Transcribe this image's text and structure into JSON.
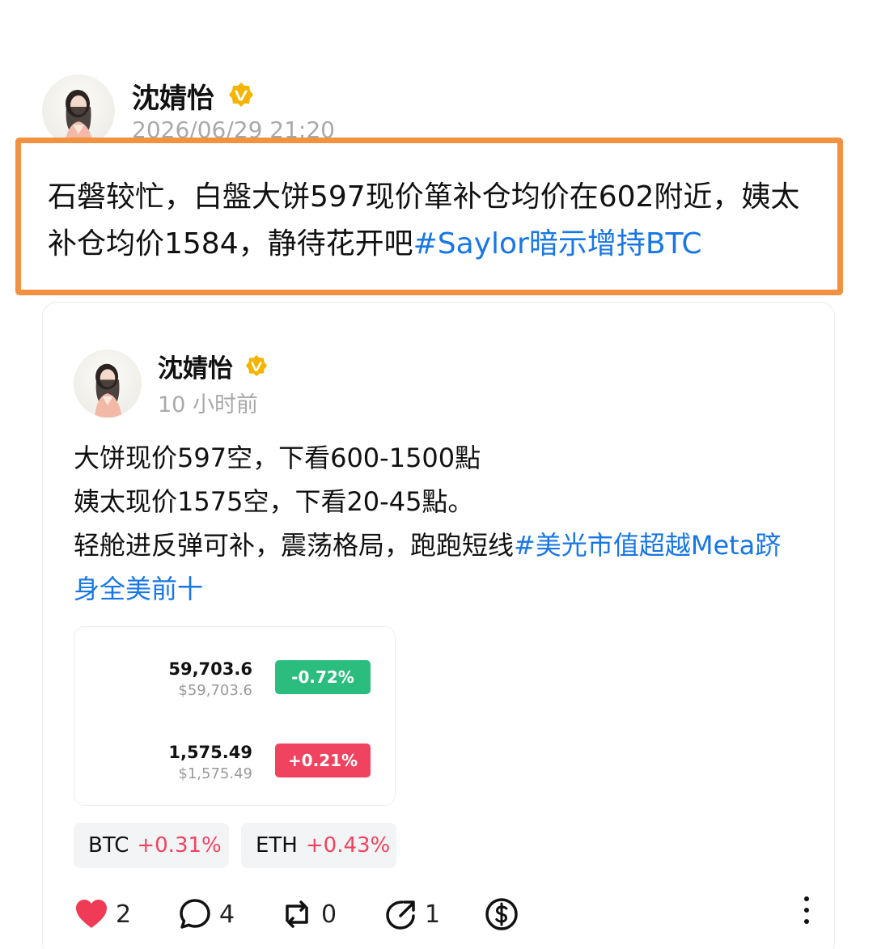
{
  "outer_post": {
    "author": "沈婧怡",
    "timestamp": "2026/06/29 21:20",
    "text": "石磐较忙，白盤大饼597现价箪补仓均价在602附近，姨太补仓均价1584，静待花开吧",
    "hashtag": "#Saylor暗示增持BTC"
  },
  "quoted_post": {
    "author": "沈婧怡",
    "timestamp": "10 小时前",
    "lines": [
      "大饼现价597空，下看600-1500點",
      "姨太现价1575空，下看20-45點。"
    ],
    "line3": "轻舱进反弹可补，震荡格局，跑跑短线",
    "hashtag": "#美光市值超越Meta跻身全美前十"
  },
  "price_card": {
    "rows": [
      {
        "price": "59,703.6",
        "usd": "$59,703.6",
        "change": "-0.72%",
        "color": "#2bbd7e"
      },
      {
        "price": "1,575.49",
        "usd": "$1,575.49",
        "change": "+0.21%",
        "color": "#f0435f"
      }
    ]
  },
  "tickers": [
    {
      "symbol": "BTC",
      "change": "+0.31%"
    },
    {
      "symbol": "ETH",
      "change": "+0.43%"
    }
  ],
  "actions": {
    "likes": "2",
    "comments": "4",
    "reposts": "0",
    "shares": "1"
  },
  "colors": {
    "highlight_border": "#f2913f",
    "hashtag": "#1877e5",
    "badge": "#f5b400",
    "like": "#ef3b56",
    "positive_change": "#f0435f",
    "negative_change": "#2bbd7e"
  },
  "icons": [
    "avatar-portrait",
    "verified-badge-icon",
    "heart-icon",
    "comment-icon",
    "repost-icon",
    "share-icon",
    "tip-dollar-icon",
    "more-icon"
  ]
}
